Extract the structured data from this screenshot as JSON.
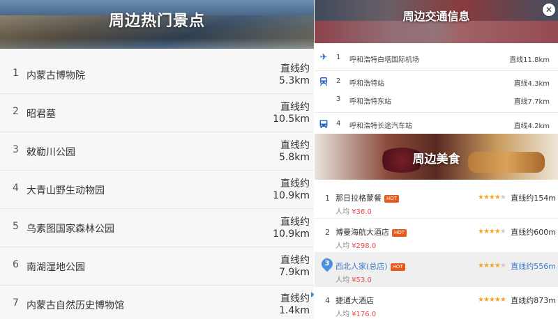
{
  "attractions": {
    "title": "周边热门景点",
    "distance_label": "直线约",
    "items": [
      {
        "num": "1",
        "name": "内蒙古博物院",
        "distance": "5.3km"
      },
      {
        "num": "2",
        "name": "昭君墓",
        "distance": "10.5km"
      },
      {
        "num": "3",
        "name": "敕勒川公园",
        "distance": "5.8km"
      },
      {
        "num": "4",
        "name": "大青山野生动物园",
        "distance": "10.9km"
      },
      {
        "num": "5",
        "name": "乌素图国家森林公园",
        "distance": "10.9km"
      },
      {
        "num": "6",
        "name": "南湖湿地公园",
        "distance": "7.9km"
      },
      {
        "num": "7",
        "name": "内蒙古自然历史博物馆",
        "distance": "1.4km"
      }
    ]
  },
  "traffic": {
    "title": "周边交通信息",
    "items": [
      {
        "icon": "airplane-icon",
        "num": "1",
        "name": "呼和浩特白塔国际机场",
        "distance": "直线11.8km"
      },
      {
        "icon": "train-icon",
        "num": "2",
        "name": "呼和浩特站",
        "distance": "直线4.3km"
      },
      {
        "icon": "",
        "num": "3",
        "name": "呼和浩特东站",
        "distance": "直线7.7km"
      },
      {
        "icon": "bus-icon",
        "num": "4",
        "name": "呼和浩特长途汽车站",
        "distance": "直线4.2km"
      }
    ]
  },
  "food": {
    "title": "周边美食",
    "hot_label": "HOT",
    "price_prefix": "人均",
    "items": [
      {
        "num": "1",
        "name": "那日拉格蒙餐",
        "price": "¥36.0",
        "rating": 4,
        "distance": "直线约154m",
        "selected": false
      },
      {
        "num": "2",
        "name": "博曼海航大酒店",
        "price": "¥298.0",
        "rating": 4,
        "distance": "直线约600m",
        "selected": false
      },
      {
        "num": "3",
        "name": "西北人家(总店)",
        "price": "¥53.0",
        "rating": 4,
        "distance": "直线约556m",
        "selected": true
      },
      {
        "num": "4",
        "name": "捷通大酒店",
        "price": "¥176.0",
        "rating": 5,
        "distance": "直线约873m",
        "selected": false
      }
    ]
  },
  "close_label": "✕"
}
